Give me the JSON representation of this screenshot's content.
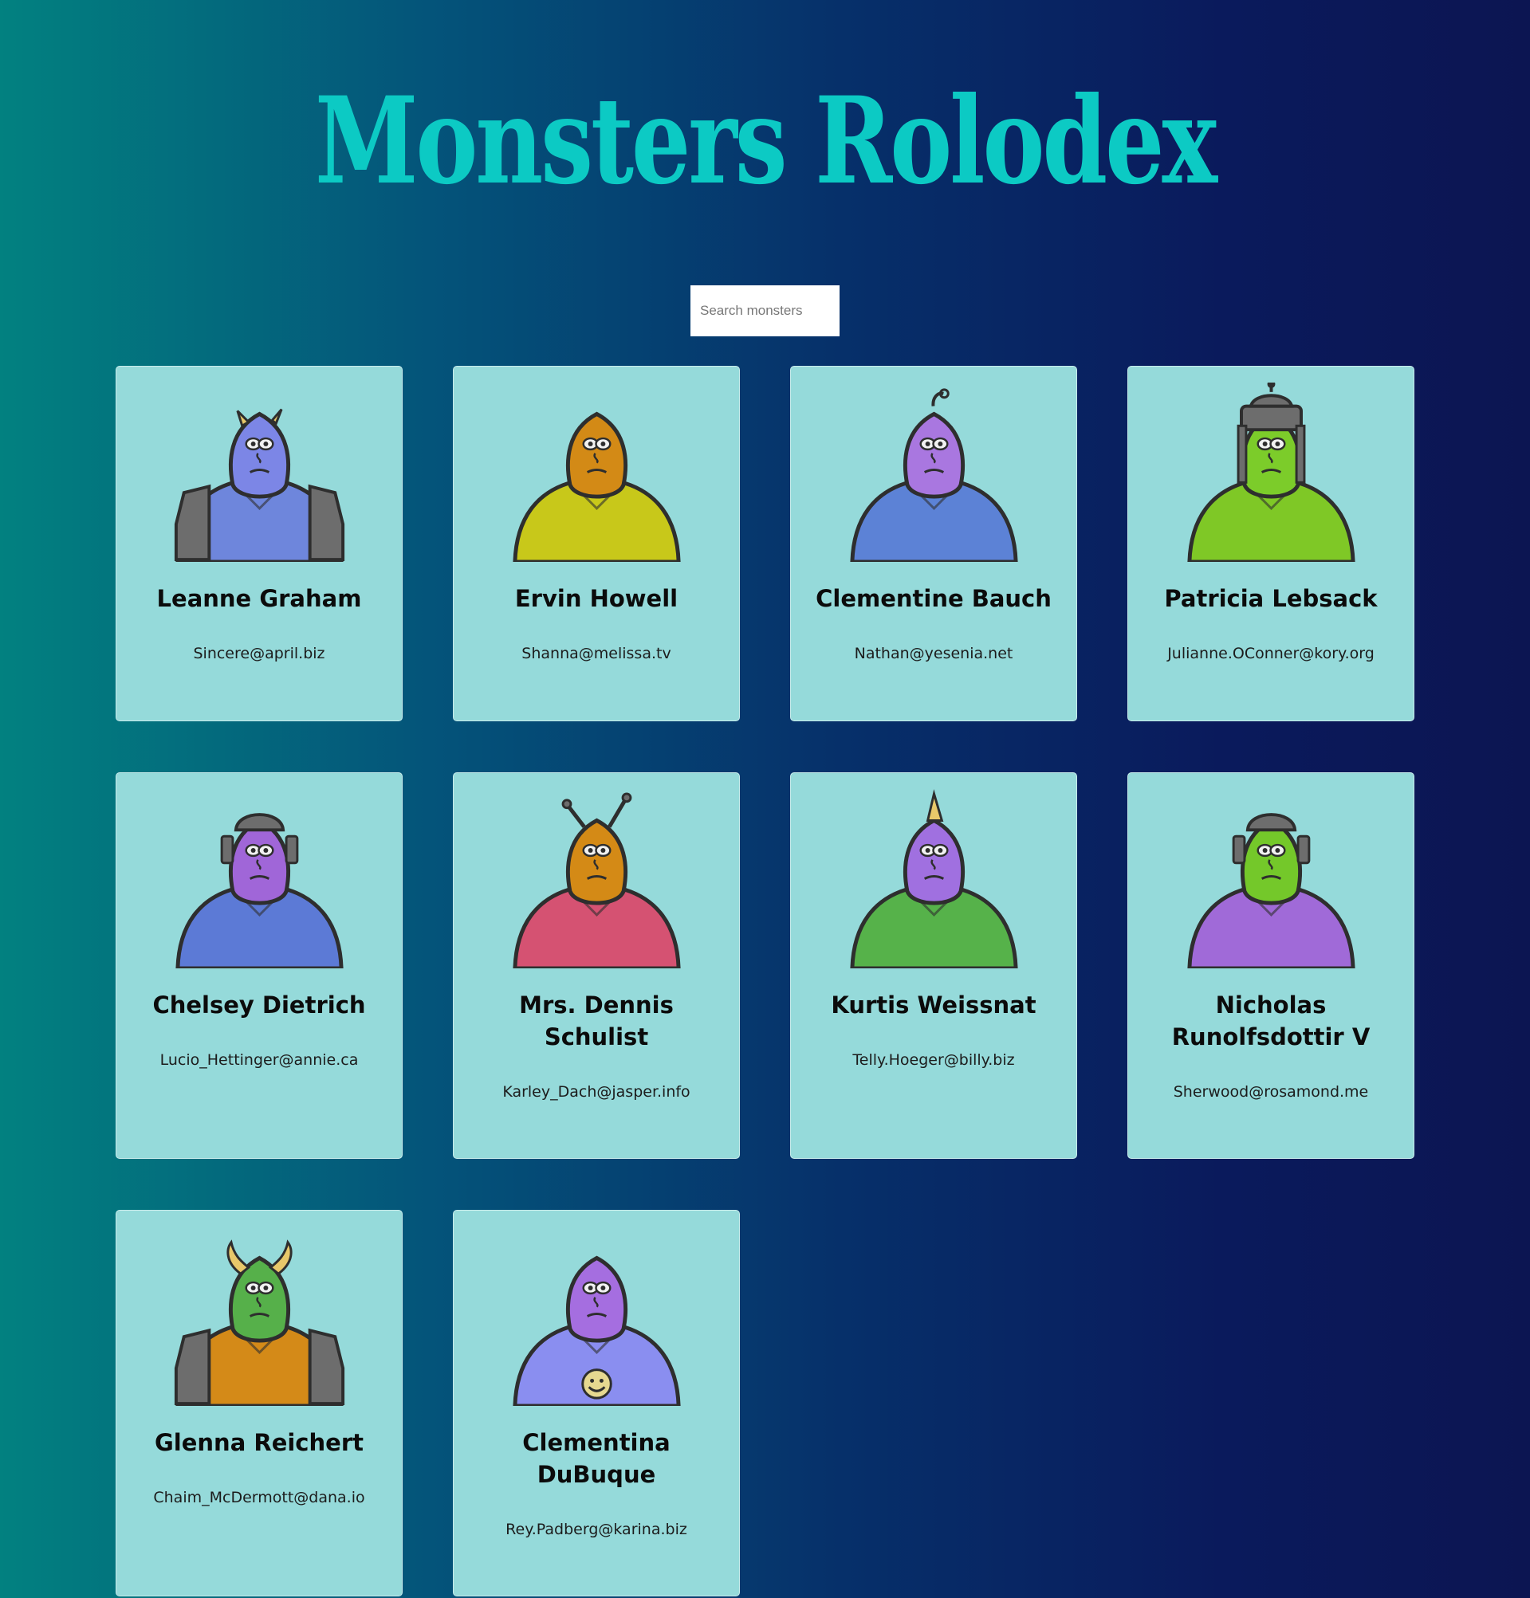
{
  "header": {
    "title": "Monsters Rolodex"
  },
  "search": {
    "placeholder": "Search monsters",
    "value": ""
  },
  "monsters": [
    {
      "name": "Leanne Graham",
      "email": "Sincere@april.biz",
      "skin": "#7c86e6",
      "body": "#6e86dc",
      "accessory": "horns"
    },
    {
      "name": "Ervin Howell",
      "email": "Shanna@melissa.tv",
      "skin": "#d38a16",
      "body": "#c8c81a",
      "accessory": "none"
    },
    {
      "name": "Clementine Bauch",
      "email": "Nathan@yesenia.net",
      "skin": "#a977e0",
      "body": "#5c82d6",
      "accessory": "antenna"
    },
    {
      "name": "Patricia Lebsack",
      "email": "Julianne.OConner@kory.org",
      "skin": "#7ccc2a",
      "body": "#7fc826",
      "accessory": "helmet"
    },
    {
      "name": "Chelsey Dietrich",
      "email": "Lucio_Hettinger@annie.ca",
      "skin": "#a066d8",
      "body": "#5c7ad6",
      "accessory": "headgear"
    },
    {
      "name": "Mrs. Dennis Schulist",
      "email": "Karley_Dach@jasper.info",
      "skin": "#d48a16",
      "body": "#d55272",
      "accessory": "antennae"
    },
    {
      "name": "Kurtis Weissnat",
      "email": "Telly.Hoeger@billy.biz",
      "skin": "#a070e0",
      "body": "#56b24a",
      "accessory": "horn"
    },
    {
      "name": "Nicholas Runolfsdottir V",
      "email": "Sherwood@rosamond.me",
      "skin": "#74c82a",
      "body": "#a06ad8",
      "accessory": "headgear"
    },
    {
      "name": "Glenna Reichert",
      "email": "Chaim_McDermott@dana.io",
      "skin": "#56b04a",
      "body": "#d48a18",
      "accessory": "horns-big"
    },
    {
      "name": "Clementina DuBuque",
      "email": "Rey.Padberg@karina.biz",
      "skin": "#a56ee0",
      "body": "#8a8ef0",
      "accessory": "smiley"
    }
  ]
}
